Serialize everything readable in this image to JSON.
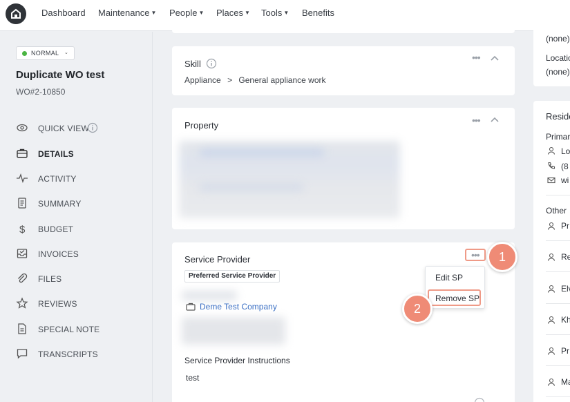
{
  "nav": {
    "items": [
      {
        "label": "Dashboard",
        "has_caret": false
      },
      {
        "label": "Maintenance",
        "has_caret": true
      },
      {
        "label": "People",
        "has_caret": true
      },
      {
        "label": "Places",
        "has_caret": true
      },
      {
        "label": "Tools",
        "has_caret": true
      },
      {
        "label": "Benefits",
        "has_caret": false
      }
    ]
  },
  "status": {
    "label": "NORMAL",
    "color": "#4bb543"
  },
  "work_order": {
    "title": "Duplicate WO test",
    "number": "WO#2-10850"
  },
  "sidebar": {
    "items": [
      {
        "label": "QUICK VIEW",
        "icon": "eye-icon",
        "active": false
      },
      {
        "label": "DETAILS",
        "icon": "briefcase-icon",
        "active": true
      },
      {
        "label": "ACTIVITY",
        "icon": "pulse-icon",
        "active": false
      },
      {
        "label": "SUMMARY",
        "icon": "document-icon",
        "active": false
      },
      {
        "label": "BUDGET",
        "icon": "dollar-icon",
        "active": false
      },
      {
        "label": "INVOICES",
        "icon": "inbox-icon",
        "active": false
      },
      {
        "label": "FILES",
        "icon": "paperclip-icon",
        "active": false
      },
      {
        "label": "REVIEWS",
        "icon": "star-icon",
        "active": false
      },
      {
        "label": "SPECIAL NOTE",
        "icon": "note-icon",
        "active": false
      },
      {
        "label": "TRANSCRIPTS",
        "icon": "chat-icon",
        "active": false
      }
    ]
  },
  "skill": {
    "title": "Skill",
    "category": "Appliance",
    "separator": ">",
    "subcategory": "General appliance work"
  },
  "property": {
    "title": "Property"
  },
  "service_provider": {
    "title": "Service Provider",
    "badge": "Preferred Service Provider",
    "company": "Deme Test Company",
    "instructions_title": "Service Provider Instructions",
    "instructions": "test",
    "menu": {
      "edit": "Edit SP",
      "remove": "Remove SP"
    }
  },
  "callouts": {
    "first": "1",
    "second": "2"
  },
  "right_col": {
    "none1": "(none)",
    "location_label": "Locatio",
    "none2": "(none)",
    "resident_title": "Reside",
    "primary_label": "Primar",
    "primary_name": "Lo",
    "primary_phone": "(8",
    "primary_email": "wi",
    "other_label": "Other",
    "others": [
      "Pr",
      "Re",
      "Elv",
      "Kh",
      "Pr",
      "Ma"
    ]
  },
  "colors": {
    "accent_link": "#3a6fc4",
    "callout": "#ef8b76",
    "highlight": "#ef9a87"
  }
}
